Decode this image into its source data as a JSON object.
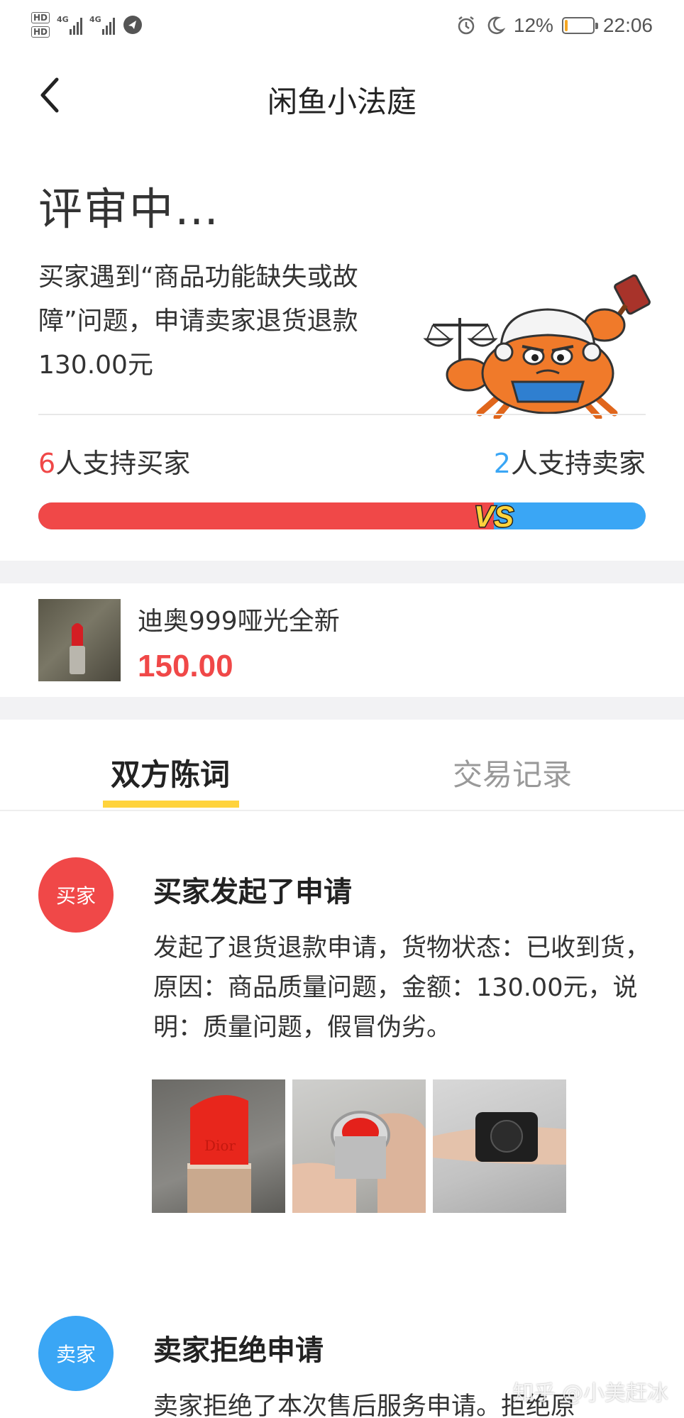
{
  "status_bar": {
    "hd1": "HD",
    "hd2": "HD",
    "network1": "4G",
    "network2": "4G",
    "battery_percent": "12%",
    "battery_level": 0.12,
    "time": "22:06",
    "icons": [
      "alarm-icon",
      "moon-icon",
      "battery-icon",
      "signal-icon",
      "app-icon"
    ]
  },
  "nav": {
    "title": "闲鱼小法庭",
    "back_icon": "chevron-left-icon"
  },
  "case": {
    "status": "评审中…",
    "description": "买家遇到“商品功能缺失或故障”问题，申请卖家退货退款130.00元",
    "buyer_supporters_count": "6",
    "buyer_supporters_label": "人支持买家",
    "seller_supporters_count": "2",
    "seller_supporters_label": "人支持卖家",
    "vs_label": "VS",
    "buyer_share": 0.75
  },
  "product": {
    "name": "迪奥999哑光全新",
    "price": "150.00"
  },
  "tabs": {
    "active": "双方陈词",
    "inactive": "交易记录"
  },
  "timeline": [
    {
      "role": "买家",
      "title": "买家发起了申请",
      "body": "发起了退货退款申请，货物状态：已收到货，原因：商品质量问题，金额：130.00元，说明：质量问题，假冒伪劣。"
    },
    {
      "role": "卖家",
      "title": "卖家拒绝申请",
      "body": "卖家拒绝了本次售后服务申请。拒绝原"
    }
  ],
  "photo_label": "Dior",
  "watermark": "知乎 @小美赶冰",
  "colors": {
    "buyer_red": "#f04848",
    "seller_blue": "#3aa6f5",
    "tab_yellow": "#ffd33c"
  }
}
